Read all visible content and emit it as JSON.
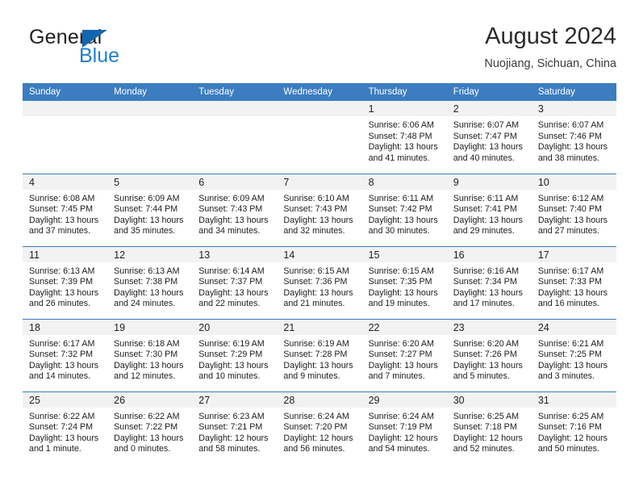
{
  "brand": {
    "name_top": "General",
    "name_bottom": "Blue",
    "accent_color": "#1f7fd0",
    "triangle_color": "#1266b1"
  },
  "header": {
    "title": "August 2024",
    "subtitle": "Nuojiang, Sichuan, China"
  },
  "calendar": {
    "header_bg": "#3b7dc0",
    "header_text_color": "#ffffff",
    "daynum_bg": "#f2f2f2",
    "weekdays": [
      "Sunday",
      "Monday",
      "Tuesday",
      "Wednesday",
      "Thursday",
      "Friday",
      "Saturday"
    ],
    "weeks": [
      [
        {
          "day": "",
          "sunrise": "",
          "sunset": "",
          "daylight_line1": "",
          "daylight_line2": "",
          "empty": true
        },
        {
          "day": "",
          "sunrise": "",
          "sunset": "",
          "daylight_line1": "",
          "daylight_line2": "",
          "empty": true
        },
        {
          "day": "",
          "sunrise": "",
          "sunset": "",
          "daylight_line1": "",
          "daylight_line2": "",
          "empty": true
        },
        {
          "day": "",
          "sunrise": "",
          "sunset": "",
          "daylight_line1": "",
          "daylight_line2": "",
          "empty": true
        },
        {
          "day": "1",
          "sunrise": "Sunrise: 6:06 AM",
          "sunset": "Sunset: 7:48 PM",
          "daylight_line1": "Daylight: 13 hours",
          "daylight_line2": "and 41 minutes."
        },
        {
          "day": "2",
          "sunrise": "Sunrise: 6:07 AM",
          "sunset": "Sunset: 7:47 PM",
          "daylight_line1": "Daylight: 13 hours",
          "daylight_line2": "and 40 minutes."
        },
        {
          "day": "3",
          "sunrise": "Sunrise: 6:07 AM",
          "sunset": "Sunset: 7:46 PM",
          "daylight_line1": "Daylight: 13 hours",
          "daylight_line2": "and 38 minutes."
        }
      ],
      [
        {
          "day": "4",
          "sunrise": "Sunrise: 6:08 AM",
          "sunset": "Sunset: 7:45 PM",
          "daylight_line1": "Daylight: 13 hours",
          "daylight_line2": "and 37 minutes."
        },
        {
          "day": "5",
          "sunrise": "Sunrise: 6:09 AM",
          "sunset": "Sunset: 7:44 PM",
          "daylight_line1": "Daylight: 13 hours",
          "daylight_line2": "and 35 minutes."
        },
        {
          "day": "6",
          "sunrise": "Sunrise: 6:09 AM",
          "sunset": "Sunset: 7:43 PM",
          "daylight_line1": "Daylight: 13 hours",
          "daylight_line2": "and 34 minutes."
        },
        {
          "day": "7",
          "sunrise": "Sunrise: 6:10 AM",
          "sunset": "Sunset: 7:43 PM",
          "daylight_line1": "Daylight: 13 hours",
          "daylight_line2": "and 32 minutes."
        },
        {
          "day": "8",
          "sunrise": "Sunrise: 6:11 AM",
          "sunset": "Sunset: 7:42 PM",
          "daylight_line1": "Daylight: 13 hours",
          "daylight_line2": "and 30 minutes."
        },
        {
          "day": "9",
          "sunrise": "Sunrise: 6:11 AM",
          "sunset": "Sunset: 7:41 PM",
          "daylight_line1": "Daylight: 13 hours",
          "daylight_line2": "and 29 minutes."
        },
        {
          "day": "10",
          "sunrise": "Sunrise: 6:12 AM",
          "sunset": "Sunset: 7:40 PM",
          "daylight_line1": "Daylight: 13 hours",
          "daylight_line2": "and 27 minutes."
        }
      ],
      [
        {
          "day": "11",
          "sunrise": "Sunrise: 6:13 AM",
          "sunset": "Sunset: 7:39 PM",
          "daylight_line1": "Daylight: 13 hours",
          "daylight_line2": "and 26 minutes."
        },
        {
          "day": "12",
          "sunrise": "Sunrise: 6:13 AM",
          "sunset": "Sunset: 7:38 PM",
          "daylight_line1": "Daylight: 13 hours",
          "daylight_line2": "and 24 minutes."
        },
        {
          "day": "13",
          "sunrise": "Sunrise: 6:14 AM",
          "sunset": "Sunset: 7:37 PM",
          "daylight_line1": "Daylight: 13 hours",
          "daylight_line2": "and 22 minutes."
        },
        {
          "day": "14",
          "sunrise": "Sunrise: 6:15 AM",
          "sunset": "Sunset: 7:36 PM",
          "daylight_line1": "Daylight: 13 hours",
          "daylight_line2": "and 21 minutes."
        },
        {
          "day": "15",
          "sunrise": "Sunrise: 6:15 AM",
          "sunset": "Sunset: 7:35 PM",
          "daylight_line1": "Daylight: 13 hours",
          "daylight_line2": "and 19 minutes."
        },
        {
          "day": "16",
          "sunrise": "Sunrise: 6:16 AM",
          "sunset": "Sunset: 7:34 PM",
          "daylight_line1": "Daylight: 13 hours",
          "daylight_line2": "and 17 minutes."
        },
        {
          "day": "17",
          "sunrise": "Sunrise: 6:17 AM",
          "sunset": "Sunset: 7:33 PM",
          "daylight_line1": "Daylight: 13 hours",
          "daylight_line2": "and 16 minutes."
        }
      ],
      [
        {
          "day": "18",
          "sunrise": "Sunrise: 6:17 AM",
          "sunset": "Sunset: 7:32 PM",
          "daylight_line1": "Daylight: 13 hours",
          "daylight_line2": "and 14 minutes."
        },
        {
          "day": "19",
          "sunrise": "Sunrise: 6:18 AM",
          "sunset": "Sunset: 7:30 PM",
          "daylight_line1": "Daylight: 13 hours",
          "daylight_line2": "and 12 minutes."
        },
        {
          "day": "20",
          "sunrise": "Sunrise: 6:19 AM",
          "sunset": "Sunset: 7:29 PM",
          "daylight_line1": "Daylight: 13 hours",
          "daylight_line2": "and 10 minutes."
        },
        {
          "day": "21",
          "sunrise": "Sunrise: 6:19 AM",
          "sunset": "Sunset: 7:28 PM",
          "daylight_line1": "Daylight: 13 hours",
          "daylight_line2": "and 9 minutes."
        },
        {
          "day": "22",
          "sunrise": "Sunrise: 6:20 AM",
          "sunset": "Sunset: 7:27 PM",
          "daylight_line1": "Daylight: 13 hours",
          "daylight_line2": "and 7 minutes."
        },
        {
          "day": "23",
          "sunrise": "Sunrise: 6:20 AM",
          "sunset": "Sunset: 7:26 PM",
          "daylight_line1": "Daylight: 13 hours",
          "daylight_line2": "and 5 minutes."
        },
        {
          "day": "24",
          "sunrise": "Sunrise: 6:21 AM",
          "sunset": "Sunset: 7:25 PM",
          "daylight_line1": "Daylight: 13 hours",
          "daylight_line2": "and 3 minutes."
        }
      ],
      [
        {
          "day": "25",
          "sunrise": "Sunrise: 6:22 AM",
          "sunset": "Sunset: 7:24 PM",
          "daylight_line1": "Daylight: 13 hours",
          "daylight_line2": "and 1 minute."
        },
        {
          "day": "26",
          "sunrise": "Sunrise: 6:22 AM",
          "sunset": "Sunset: 7:22 PM",
          "daylight_line1": "Daylight: 13 hours",
          "daylight_line2": "and 0 minutes."
        },
        {
          "day": "27",
          "sunrise": "Sunrise: 6:23 AM",
          "sunset": "Sunset: 7:21 PM",
          "daylight_line1": "Daylight: 12 hours",
          "daylight_line2": "and 58 minutes."
        },
        {
          "day": "28",
          "sunrise": "Sunrise: 6:24 AM",
          "sunset": "Sunset: 7:20 PM",
          "daylight_line1": "Daylight: 12 hours",
          "daylight_line2": "and 56 minutes."
        },
        {
          "day": "29",
          "sunrise": "Sunrise: 6:24 AM",
          "sunset": "Sunset: 7:19 PM",
          "daylight_line1": "Daylight: 12 hours",
          "daylight_line2": "and 54 minutes."
        },
        {
          "day": "30",
          "sunrise": "Sunrise: 6:25 AM",
          "sunset": "Sunset: 7:18 PM",
          "daylight_line1": "Daylight: 12 hours",
          "daylight_line2": "and 52 minutes."
        },
        {
          "day": "31",
          "sunrise": "Sunrise: 6:25 AM",
          "sunset": "Sunset: 7:16 PM",
          "daylight_line1": "Daylight: 12 hours",
          "daylight_line2": "and 50 minutes."
        }
      ]
    ]
  }
}
